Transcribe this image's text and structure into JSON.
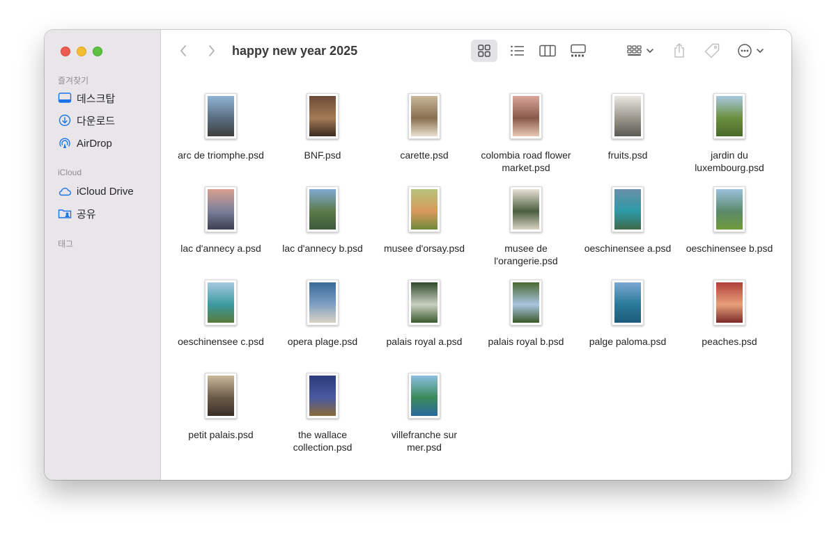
{
  "window": {
    "title": "happy new year 2025"
  },
  "sidebar": {
    "favorites_header": "즐겨찾기",
    "favorites": [
      {
        "label": "데스크탑",
        "icon": "desktop-icon"
      },
      {
        "label": "다운로드",
        "icon": "download-icon"
      },
      {
        "label": "AirDrop",
        "icon": "airdrop-icon"
      }
    ],
    "icloud_header": "iCloud",
    "icloud": [
      {
        "label": "iCloud Drive",
        "icon": "icloud-icon"
      },
      {
        "label": "공유",
        "icon": "shared-folder-icon"
      }
    ],
    "tags_header": "태그"
  },
  "colors": {
    "accent": "#1a73e8",
    "sidebar_bg": "#e8e6e8"
  },
  "files": [
    {
      "name": "arc de triomphe.psd",
      "thumb": [
        "#8fb3d4",
        "#5b6e80",
        "#3d3f3c"
      ]
    },
    {
      "name": "BNF.psd",
      "thumb": [
        "#6b4a35",
        "#a57b56",
        "#3a2a20"
      ]
    },
    {
      "name": "carette.psd",
      "thumb": [
        "#c9b79a",
        "#8a6e4e",
        "#e9e0d0"
      ]
    },
    {
      "name": "colombia road flower market.psd",
      "thumb": [
        "#d9a59a",
        "#8a5a48",
        "#e7c8b5"
      ]
    },
    {
      "name": "fruits.psd",
      "thumb": [
        "#e9e7e2",
        "#9a968c",
        "#5b5a52"
      ]
    },
    {
      "name": "jardin du luxembourg.psd",
      "thumb": [
        "#a8c8e0",
        "#6b8f3e",
        "#4a6a2a"
      ]
    },
    {
      "name": "lac d'annecy a.psd",
      "thumb": [
        "#d7a08e",
        "#7a7f9a",
        "#3b3f4f"
      ]
    },
    {
      "name": "lac d'annecy b.psd",
      "thumb": [
        "#7fa9d1",
        "#5c7a4a",
        "#3b5a3a"
      ]
    },
    {
      "name": "musee d'orsay.psd",
      "thumb": [
        "#b7c27a",
        "#d99a5b",
        "#6d8a3c"
      ]
    },
    {
      "name": "musee de l'orangerie.psd",
      "thumb": [
        "#e8e1d6",
        "#4a5f3f",
        "#d9d2c4"
      ]
    },
    {
      "name": "oeschinensee a.psd",
      "thumb": [
        "#6a8fa8",
        "#2c9aa8",
        "#3f6a4a"
      ]
    },
    {
      "name": "oeschinensee b.psd",
      "thumb": [
        "#9ac0dc",
        "#5a8a6a",
        "#6f9a3a"
      ]
    },
    {
      "name": "oeschinensee c.psd",
      "thumb": [
        "#a9c9e0",
        "#3a9aa0",
        "#5a7a3a"
      ]
    },
    {
      "name": "opera plage.psd",
      "thumb": [
        "#3a6a9a",
        "#7e9fc2",
        "#d9d2c4"
      ]
    },
    {
      "name": "palais royal a.psd",
      "thumb": [
        "#2f4a2a",
        "#c9d0c0",
        "#3b5a2f"
      ]
    },
    {
      "name": "palais royal b.psd",
      "thumb": [
        "#4a6a30",
        "#a9c4e0",
        "#3a5a28"
      ]
    },
    {
      "name": "palge paloma.psd",
      "thumb": [
        "#7aa8d0",
        "#2a7a9a",
        "#1f5a7a"
      ]
    },
    {
      "name": "peaches.psd",
      "thumb": [
        "#b0403a",
        "#e8a07a",
        "#7a2a2a"
      ]
    },
    {
      "name": "petit palais.psd",
      "thumb": [
        "#c9b99a",
        "#6a5a48",
        "#3a2f28"
      ]
    },
    {
      "name": "the wallace collection.psd",
      "thumb": [
        "#2a3a7a",
        "#4a5aa0",
        "#8a6a3a"
      ]
    },
    {
      "name": "villefranche sur mer.psd",
      "thumb": [
        "#8ac0e0",
        "#3a8a5a",
        "#2a6aa0"
      ]
    }
  ]
}
